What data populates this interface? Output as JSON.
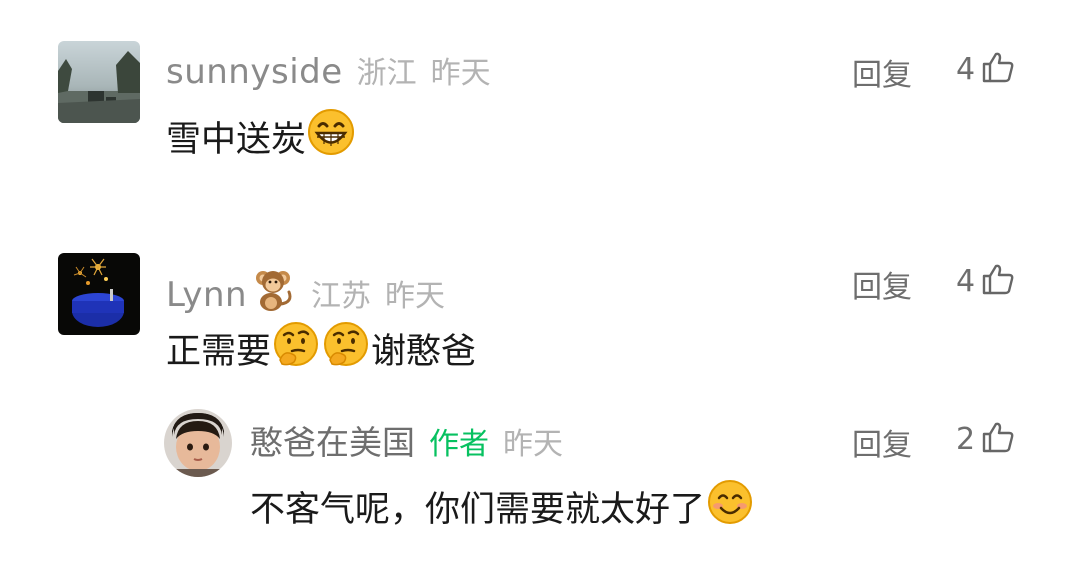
{
  "comments": [
    {
      "username": "sunnyside",
      "location": "浙江",
      "time": "昨天",
      "text_before": "雪中送炭",
      "text_after": "",
      "reply_label": "回复",
      "like_count": "4"
    },
    {
      "username": "Lynn",
      "location": "江苏",
      "time": "昨天",
      "text_before": "正需要",
      "text_after": "谢憨爸",
      "reply_label": "回复",
      "like_count": "4",
      "reply": {
        "username": "憨爸在美国",
        "author_tag": "作者",
        "time": "昨天",
        "text_before": "不客气呢，你们需要就太好了",
        "reply_label": "回复",
        "like_count": "2"
      }
    }
  ],
  "icons": {
    "like": "thumbs-up-icon",
    "grin": "grinning-face-emoji",
    "thinking": "thinking-face-emoji",
    "smile": "smiling-face-emoji",
    "monkey": "monkey-badge"
  },
  "colors": {
    "author_tag": "#07c160",
    "meta_gray": "#b3b3b3",
    "name_gray": "#8a8a8a",
    "text": "#1a1a1a"
  }
}
